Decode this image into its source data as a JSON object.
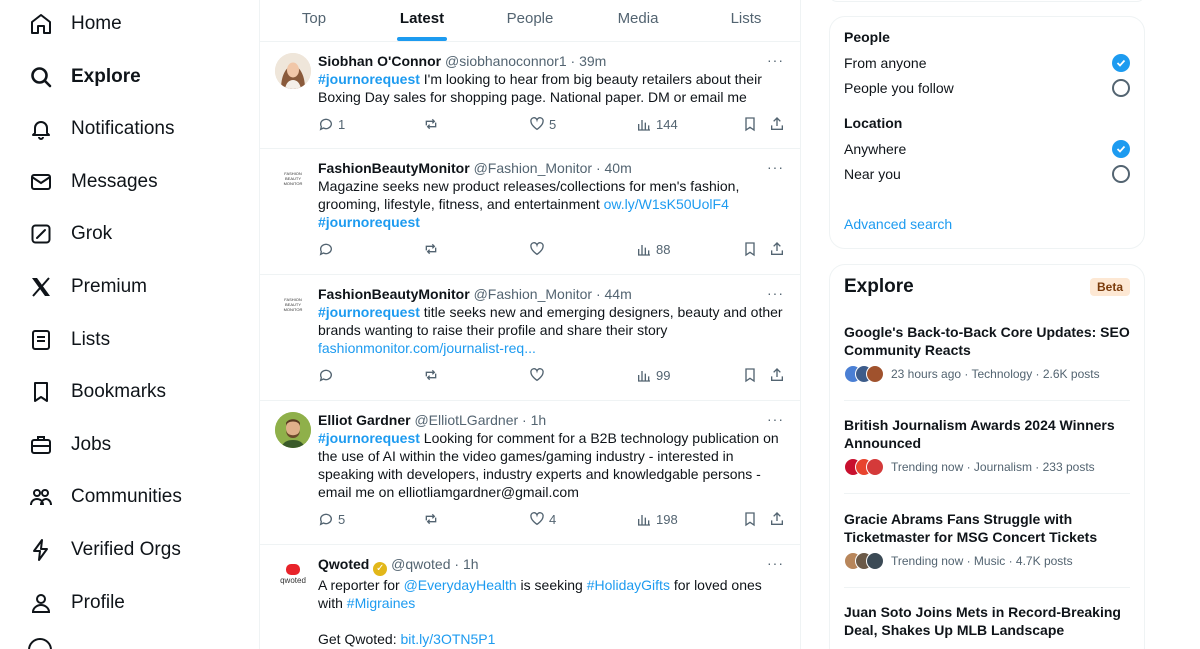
{
  "nav": {
    "items": [
      {
        "label": "Home",
        "icon": "home-icon"
      },
      {
        "label": "Explore",
        "icon": "search-icon"
      },
      {
        "label": "Notifications",
        "icon": "bell-icon"
      },
      {
        "label": "Messages",
        "icon": "envelope-icon"
      },
      {
        "label": "Grok",
        "icon": "grok-icon"
      },
      {
        "label": "Premium",
        "icon": "x-logo-icon"
      },
      {
        "label": "Lists",
        "icon": "list-icon"
      },
      {
        "label": "Bookmarks",
        "icon": "bookmark-icon"
      },
      {
        "label": "Jobs",
        "icon": "briefcase-icon"
      },
      {
        "label": "Communities",
        "icon": "people-icon"
      },
      {
        "label": "Verified Orgs",
        "icon": "lightning-icon"
      },
      {
        "label": "Profile",
        "icon": "person-icon"
      }
    ],
    "active": "Explore"
  },
  "tabs": [
    "Top",
    "Latest",
    "People",
    "Media",
    "Lists"
  ],
  "active_tab": "Latest",
  "tweets": [
    {
      "name": "Siobhan O'Connor",
      "handle": "@siobhanoconnor1",
      "time": "39m",
      "hashtag": "#journorequest",
      "text": " I'm looking to hear from big beauty retailers about their Boxing Day sales for shopping page. National paper. DM or email me",
      "replies": "1",
      "likes": "5",
      "views": "144"
    },
    {
      "name": "FashionBeautyMonitor",
      "handle": "@Fashion_Monitor",
      "time": "40m",
      "text": "Magazine seeks new product releases/collections for men's fashion, grooming, lifestyle, fitness, and entertainment ",
      "link": "ow.ly/W1sK50UolF4",
      "hashtag": "#journorequest",
      "replies": "",
      "likes": "",
      "views": "88",
      "avatar_text": "FASHION BEAUTY MONITOR"
    },
    {
      "name": "FashionBeautyMonitor",
      "handle": "@Fashion_Monitor",
      "time": "44m",
      "hashtag": "#journorequest",
      "text": " title seeks new and emerging designers, beauty and other brands wanting to raise their profile and share their story",
      "link": "fashionmonitor.com/journalist-req...",
      "replies": "",
      "likes": "",
      "views": "99",
      "avatar_text": "FASHION BEAUTY MONITOR"
    },
    {
      "name": "Elliot Gardner",
      "handle": "@ElliotLGardner",
      "time": "1h",
      "hashtag": "#journorequest",
      "text": " Looking for comment for a B2B technology publication on the use of AI within the video games/gaming industry - interested in speaking with developers, industry experts and knowledgable persons - email me on elliotliamgardner@gmail.com",
      "replies": "5",
      "likes": "4",
      "views": "198"
    },
    {
      "name": "Qwoted",
      "handle": "@qwoted",
      "time": "1h",
      "text_a": "A reporter for ",
      "mention": "@EverydayHealth",
      "text_b": " is seeking ",
      "tag2": "#HolidayGifts",
      "text_c": " for loved ones with ",
      "tag3": "#Migraines",
      "get_label": "Get Qwoted: ",
      "get_link": "bit.ly/3OTN5P1",
      "avatar_text": "qwoted"
    }
  ],
  "filters": {
    "people_head": "People",
    "people_opts": [
      "From anyone",
      "People you follow"
    ],
    "location_head": "Location",
    "location_opts": [
      "Anywhere",
      "Near you"
    ],
    "advanced": "Advanced search"
  },
  "explore": {
    "title": "Explore",
    "badge": "Beta",
    "trends": [
      {
        "title": "Google's Back-to-Back Core Updates: SEO Community Reacts",
        "meta": "23 hours ago · Technology · 2.6K posts"
      },
      {
        "title": "British Journalism Awards 2024 Winners Announced",
        "meta": "Trending now · Journalism · 233 posts"
      },
      {
        "title": "Gracie Abrams Fans Struggle with Ticketmaster for MSG Concert Tickets",
        "meta": "Trending now · Music · 4.7K posts"
      },
      {
        "title": "Juan Soto Joins Mets in Record-Breaking Deal, Shakes Up MLB Landscape",
        "meta": ""
      }
    ]
  },
  "colors": {
    "accent": "#1d9bf0",
    "text": "#0f1419",
    "secondary": "#536471",
    "border": "#eff3f4"
  }
}
